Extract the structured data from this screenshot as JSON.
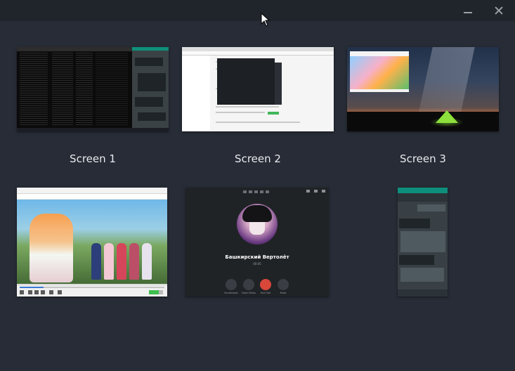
{
  "window": {
    "minimize_label": "",
    "close_label": ""
  },
  "screens": [
    {
      "label": "Screen 1"
    },
    {
      "label": "Screen 2"
    },
    {
      "label": "Screen 3"
    }
  ],
  "windows": [
    {
      "kind": "video-player"
    },
    {
      "kind": "call",
      "caller_name": "Башкирский Вертолёт",
      "timer": "00:05",
      "buttons": [
        "Screenshot",
        "Start Video",
        "End Call",
        "Mute"
      ]
    },
    {
      "kind": "chat"
    }
  ],
  "colors": {
    "background": "#272c36",
    "titlebar": "#20242b",
    "label": "#e8eaed",
    "end_call": "#d9473b",
    "chat_accent": "#0e8f7c"
  }
}
